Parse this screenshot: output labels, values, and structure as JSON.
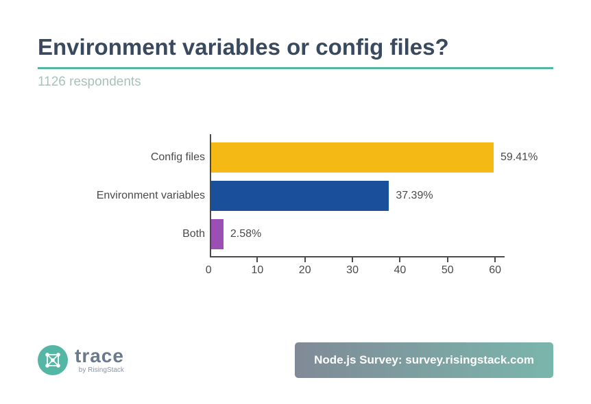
{
  "title": "Environment variables or config files?",
  "subtitle": "1126 respondents",
  "footer": {
    "logo_main": "trace",
    "logo_sub": "by RisingStack",
    "survey_text": "Node.js Survey: survey.risingstack.com"
  },
  "chart_data": {
    "type": "bar",
    "orientation": "horizontal",
    "categories": [
      "Config files",
      "Environment variables",
      "Both"
    ],
    "values": [
      59.41,
      37.39,
      2.58
    ],
    "value_labels": [
      "59.41%",
      "37.39%",
      "2.58%"
    ],
    "colors": [
      "#f5b916",
      "#1a4f9c",
      "#9b4fb5"
    ],
    "xlim": [
      0,
      62
    ],
    "xticks": [
      0,
      10,
      20,
      30,
      40,
      50,
      60
    ],
    "title": "Environment variables or config files?",
    "xlabel": "",
    "ylabel": ""
  }
}
